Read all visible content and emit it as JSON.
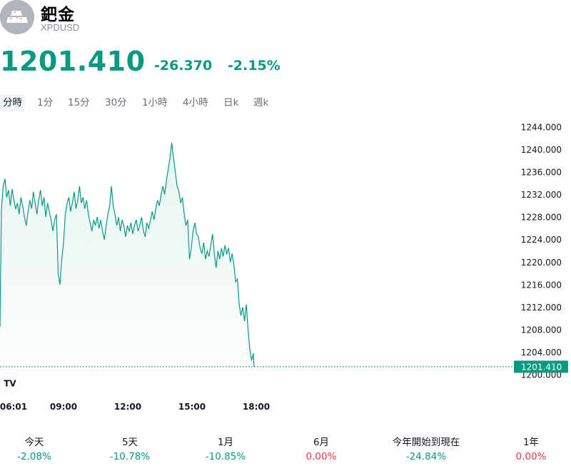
{
  "asset": {
    "name": "鈀金",
    "symbol": "XPDUSD",
    "icon": "gold-bars-icon"
  },
  "quote": {
    "price": "1201.410",
    "change": "-26.370",
    "change_percent": "-2.15%"
  },
  "colors": {
    "positive": "#089981",
    "negative": "#f23645",
    "neutral": "#131722"
  },
  "timeframes": {
    "items": [
      "分時",
      "1分",
      "15分",
      "30分",
      "1小時",
      "4小時",
      "日k",
      "週k"
    ],
    "selected": "分時"
  },
  "chart_data": {
    "type": "area",
    "x_ticks": [
      "06:01",
      "09:00",
      "12:00",
      "15:00",
      "18:00"
    ],
    "y_ticks": [
      "1200.000",
      "1204.000",
      "1208.000",
      "1212.000",
      "1216.000",
      "1220.000",
      "1224.000",
      "1228.000",
      "1232.000",
      "1236.000",
      "1240.000",
      "1244.000"
    ],
    "ylim": [
      1200,
      1244
    ],
    "last_price_label": "1201.410",
    "last_price": 1201.41,
    "series": [
      {
        "points": [
          [
            "06:01",
            1208.5
          ],
          [
            "06:05",
            1229.5
          ],
          [
            "06:10",
            1233.5
          ],
          [
            "06:15",
            1234.8
          ],
          [
            "06:20",
            1231.5
          ],
          [
            "06:25",
            1232.8
          ],
          [
            "06:30",
            1230.0
          ],
          [
            "06:35",
            1233.0
          ],
          [
            "06:40",
            1231.0
          ],
          [
            "06:45",
            1229.5
          ],
          [
            "06:50",
            1230.5
          ],
          [
            "06:55",
            1228.5
          ],
          [
            "07:00",
            1231.5
          ],
          [
            "07:05",
            1230.0
          ],
          [
            "07:10",
            1228.0
          ],
          [
            "07:15",
            1226.5
          ],
          [
            "07:20",
            1229.0
          ],
          [
            "07:25",
            1231.0
          ],
          [
            "07:30",
            1229.5
          ],
          [
            "07:35",
            1232.5
          ],
          [
            "07:40",
            1230.5
          ],
          [
            "07:45",
            1228.5
          ],
          [
            "07:50",
            1231.0
          ],
          [
            "07:55",
            1232.8
          ],
          [
            "08:00",
            1230.0
          ],
          [
            "08:05",
            1231.5
          ],
          [
            "08:10",
            1228.0
          ],
          [
            "08:15",
            1230.5
          ],
          [
            "08:20",
            1229.0
          ],
          [
            "08:25",
            1227.5
          ],
          [
            "08:30",
            1225.5
          ],
          [
            "08:35",
            1227.5
          ],
          [
            "08:40",
            1228.5
          ],
          [
            "08:45",
            1218.0
          ],
          [
            "08:50",
            1216.0
          ],
          [
            "08:55",
            1220.5
          ],
          [
            "09:00",
            1223.5
          ],
          [
            "09:05",
            1228.5
          ],
          [
            "09:10",
            1230.5
          ],
          [
            "09:15",
            1231.5
          ],
          [
            "09:20",
            1229.0
          ],
          [
            "09:25",
            1230.5
          ],
          [
            "09:30",
            1232.5
          ],
          [
            "09:35",
            1229.5
          ],
          [
            "09:40",
            1231.0
          ],
          [
            "09:45",
            1233.5
          ],
          [
            "09:50",
            1230.5
          ],
          [
            "09:55",
            1231.5
          ],
          [
            "10:00",
            1229.5
          ],
          [
            "10:05",
            1231.0
          ],
          [
            "10:10",
            1228.5
          ],
          [
            "10:15",
            1227.0
          ],
          [
            "10:20",
            1225.5
          ],
          [
            "10:25",
            1227.5
          ],
          [
            "10:30",
            1226.5
          ],
          [
            "10:35",
            1228.0
          ],
          [
            "10:40",
            1226.0
          ],
          [
            "10:45",
            1227.5
          ],
          [
            "10:50",
            1225.5
          ],
          [
            "10:55",
            1224.0
          ],
          [
            "11:00",
            1226.5
          ],
          [
            "11:05",
            1228.5
          ],
          [
            "11:10",
            1230.0
          ],
          [
            "11:15",
            1233.5
          ],
          [
            "11:20",
            1230.0
          ],
          [
            "11:25",
            1228.5
          ],
          [
            "11:30",
            1226.5
          ],
          [
            "11:35",
            1228.0
          ],
          [
            "11:40",
            1225.5
          ],
          [
            "11:45",
            1227.5
          ],
          [
            "11:50",
            1226.5
          ],
          [
            "11:55",
            1224.5
          ],
          [
            "12:00",
            1226.5
          ],
          [
            "12:05",
            1225.5
          ],
          [
            "12:10",
            1227.0
          ],
          [
            "12:15",
            1225.0
          ],
          [
            "12:20",
            1226.5
          ],
          [
            "12:25",
            1227.5
          ],
          [
            "12:30",
            1225.5
          ],
          [
            "12:35",
            1226.5
          ],
          [
            "12:40",
            1228.0
          ],
          [
            "12:45",
            1225.5
          ],
          [
            "12:50",
            1224.5
          ],
          [
            "12:55",
            1227.0
          ],
          [
            "13:00",
            1226.0
          ],
          [
            "13:05",
            1227.5
          ],
          [
            "13:10",
            1229.0
          ],
          [
            "13:15",
            1227.5
          ],
          [
            "13:20",
            1229.5
          ],
          [
            "13:25",
            1231.0
          ],
          [
            "13:30",
            1230.0
          ],
          [
            "13:35",
            1232.0
          ],
          [
            "13:40",
            1233.5
          ],
          [
            "13:45",
            1232.0
          ],
          [
            "13:50",
            1234.5
          ],
          [
            "13:55",
            1236.5
          ],
          [
            "14:00",
            1238.5
          ],
          [
            "14:05",
            1241.2
          ],
          [
            "14:10",
            1238.5
          ],
          [
            "14:15",
            1236.0
          ],
          [
            "14:20",
            1233.5
          ],
          [
            "14:25",
            1232.5
          ],
          [
            "14:30",
            1230.5
          ],
          [
            "14:35",
            1231.5
          ],
          [
            "14:40",
            1228.5
          ],
          [
            "14:45",
            1226.5
          ],
          [
            "14:50",
            1227.5
          ],
          [
            "14:55",
            1220.5
          ],
          [
            "15:00",
            1222.5
          ],
          [
            "15:05",
            1225.5
          ],
          [
            "15:10",
            1227.0
          ],
          [
            "15:15",
            1225.0
          ],
          [
            "15:20",
            1224.5
          ],
          [
            "15:25",
            1222.5
          ],
          [
            "15:30",
            1221.5
          ],
          [
            "15:35",
            1223.5
          ],
          [
            "15:40",
            1220.5
          ],
          [
            "15:45",
            1222.0
          ],
          [
            "15:50",
            1221.0
          ],
          [
            "15:55",
            1223.0
          ],
          [
            "16:00",
            1225.0
          ],
          [
            "16:05",
            1221.5
          ],
          [
            "16:10",
            1219.0
          ],
          [
            "16:15",
            1222.0
          ],
          [
            "16:20",
            1220.5
          ],
          [
            "16:25",
            1222.5
          ],
          [
            "16:30",
            1221.0
          ],
          [
            "16:35",
            1223.0
          ],
          [
            "16:40",
            1221.5
          ],
          [
            "16:45",
            1222.5
          ],
          [
            "16:50",
            1220.0
          ],
          [
            "16:55",
            1221.5
          ],
          [
            "17:00",
            1219.5
          ],
          [
            "17:05",
            1216.5
          ],
          [
            "17:10",
            1217.0
          ],
          [
            "17:15",
            1212.5
          ],
          [
            "17:20",
            1210.5
          ],
          [
            "17:25",
            1212.0
          ],
          [
            "17:30",
            1209.5
          ],
          [
            "17:35",
            1212.5
          ],
          [
            "17:40",
            1208.0
          ],
          [
            "17:45",
            1204.5
          ],
          [
            "17:50",
            1202.5
          ],
          [
            "17:55",
            1203.8
          ],
          [
            "17:57",
            1201.41
          ]
        ]
      }
    ]
  },
  "performance": [
    {
      "label": "今天",
      "value": "-2.08%",
      "direction": "down"
    },
    {
      "label": "5天",
      "value": "-10.78%",
      "direction": "down"
    },
    {
      "label": "1月",
      "value": "-10.85%",
      "direction": "down"
    },
    {
      "label": "6月",
      "value": "0.00%",
      "direction": "flat"
    },
    {
      "label": "今年開始到現在",
      "value": "-24.84%",
      "direction": "down"
    },
    {
      "label": "1年",
      "value": "0.00%",
      "direction": "flat"
    }
  ],
  "branding": {
    "logo_text": "TV",
    "logo_icon": "tradingview-logo-icon"
  }
}
